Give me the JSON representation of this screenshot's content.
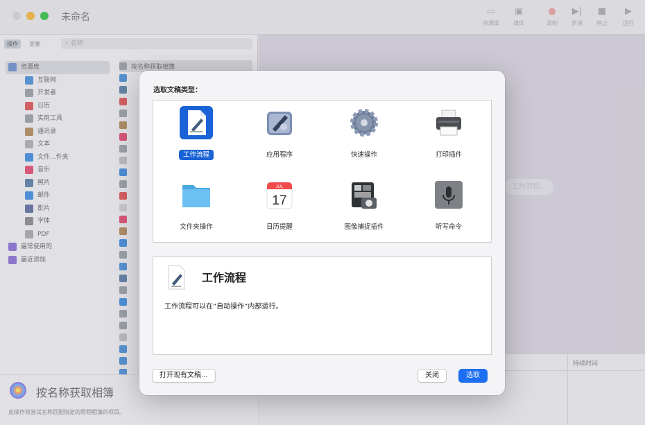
{
  "window": {
    "title": "未命名"
  },
  "toolbar": [
    {
      "label": "资源库",
      "icon": "library-icon"
    },
    {
      "label": "媒体",
      "icon": "media-icon"
    },
    {
      "label": "录制",
      "icon": "record-icon"
    },
    {
      "label": "步进",
      "icon": "step-icon"
    },
    {
      "label": "停止",
      "icon": "stop-icon"
    },
    {
      "label": "运行",
      "icon": "run-icon"
    }
  ],
  "sidebar": {
    "tabs": [
      "操作",
      "变量"
    ],
    "search_placeholder": "名称",
    "library": [
      {
        "label": "资源库",
        "icon": "library-icon",
        "color": "#6d8fcf"
      },
      {
        "label": "互联网",
        "icon": "globe-icon",
        "color": "#4a90d9"
      },
      {
        "label": "开发者",
        "icon": "tools-icon",
        "color": "#9aa0a6"
      },
      {
        "label": "日历",
        "icon": "calendar-icon",
        "color": "#e05555"
      },
      {
        "label": "实用工具",
        "icon": "utilities-icon",
        "color": "#9aa0a6"
      },
      {
        "label": "通讯录",
        "icon": "contacts-icon",
        "color": "#b38a5a"
      },
      {
        "label": "文本",
        "icon": "text-icon",
        "color": "#b0b0b0"
      },
      {
        "label": "文件...件夹",
        "icon": "finder-icon",
        "color": "#3e8de0"
      },
      {
        "label": "音乐",
        "icon": "music-icon",
        "color": "#e54b6f"
      },
      {
        "label": "照片",
        "icon": "photos-icon",
        "color": "#5b7fa8"
      },
      {
        "label": "邮件",
        "icon": "mail-icon",
        "color": "#3e8de0"
      },
      {
        "label": "影片",
        "icon": "movies-icon",
        "color": "#5c6ea0"
      },
      {
        "label": "字体",
        "icon": "fonts-icon",
        "color": "#8a8a8a"
      },
      {
        "label": "PDF",
        "icon": "pdf-icon",
        "color": "#aaaaaa"
      },
      {
        "label": "最常使用的",
        "icon": "folder-purple-icon",
        "color": "#8a6fd6"
      },
      {
        "label": "最近添加",
        "icon": "folder-purple-icon",
        "color": "#8a6fd6"
      }
    ],
    "first_action": "按名称获取相簿",
    "action_colors": [
      "#9aa0a6",
      "#4a90d9",
      "#5b7fa8",
      "#e05555",
      "#9aa0a6",
      "#b38a5a",
      "#e54b6f",
      "#9aa0a6",
      "#c0c0c0",
      "#3e8de0",
      "#9aa0a6",
      "#e05555",
      "#d1d1d1",
      "#e54b6f",
      "#b38a5a",
      "#3e8de0",
      "#9aa0a6",
      "#4a90d9",
      "#5b7fa8",
      "#9aa0a6",
      "#3e8de0",
      "#9aa0a6",
      "#9aa0a6",
      "#c0c0c0",
      "#4a90d9",
      "#4a90d9",
      "#4a90d9"
    ]
  },
  "description": {
    "title": "按名称获取相簿",
    "text": "此操作将尝试名称匹配指定的照相相簿的项目。"
  },
  "canvas": {
    "hint": "工作流程。"
  },
  "log": {
    "column": "持续时间"
  },
  "dialog": {
    "heading": "选取文稿类型：",
    "types": [
      {
        "label": "工作流程",
        "icon": "workflow-icon",
        "selected": true
      },
      {
        "label": "应用程序",
        "icon": "application-icon",
        "selected": false
      },
      {
        "label": "快速操作",
        "icon": "quick-action-gear-icon",
        "selected": false
      },
      {
        "label": "打印插件",
        "icon": "printer-icon",
        "selected": false
      },
      {
        "label": "文件夹操作",
        "icon": "folder-icon",
        "selected": false
      },
      {
        "label": "日历提醒",
        "icon": "calendar-icon",
        "selected": false
      },
      {
        "label": "图像捕捉插件",
        "icon": "image-capture-icon",
        "selected": false
      },
      {
        "label": "听写命令",
        "icon": "microphone-icon",
        "selected": false
      }
    ],
    "calendar": {
      "month": "JUL",
      "day": "17"
    },
    "info_title": "工作流程",
    "info_text": "工作流程可以在“自动操作”内部运行。",
    "open_existing": "打开现有文稿...",
    "close": "关闭",
    "choose": "选取",
    "accent": "#1d6ff2"
  }
}
